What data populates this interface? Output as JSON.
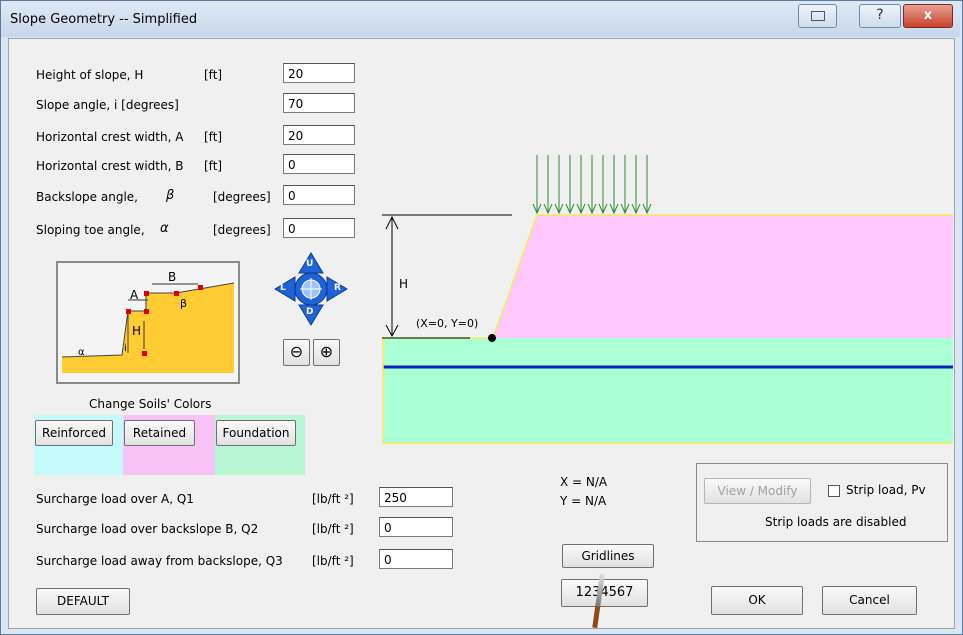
{
  "window": {
    "title": "Slope Geometry -- Simplified",
    "close_glyph": "x",
    "help_glyph": "?"
  },
  "geometry_inputs": [
    {
      "label": "Height of slope, H",
      "unit": "[ft]",
      "value": "20"
    },
    {
      "label": "Slope angle, i  [degrees]",
      "unit": "",
      "value": "70"
    },
    {
      "label": "Horizontal crest width,  A",
      "unit": "[ft]",
      "value": "20"
    },
    {
      "label": "Horizontal crest width,  B",
      "unit": "[ft]",
      "value": "0"
    },
    {
      "label": "Backslope angle,",
      "symbol": "β",
      "unit": "[degrees]",
      "value": "0"
    },
    {
      "label": "Sloping toe angle,",
      "symbol": "α",
      "unit": "[degrees]",
      "value": "0"
    }
  ],
  "schematic": {
    "labels": {
      "A": "A",
      "B": "B",
      "H": "H",
      "beta": "β",
      "i": "i",
      "alpha": "α"
    }
  },
  "navigator": {
    "up": "U",
    "down": "D",
    "left": "L",
    "right": "R"
  },
  "zoom": {
    "out": "⊖",
    "in": "⊕"
  },
  "soil_colors": {
    "title": "Change Soils' Colors",
    "buttons": [
      "Reinforced",
      "Retained",
      "Foundation"
    ],
    "swatches": [
      "#c6f9fa",
      "#f7c3f7",
      "#b9f6d6"
    ]
  },
  "surcharges": [
    {
      "label": "Surcharge load over A,  Q1",
      "unit": "[lb/ft ²]",
      "value": "250"
    },
    {
      "label": "Surcharge load over backslope B,  Q2",
      "unit": "[lb/ft ²]",
      "value": "0"
    },
    {
      "label": "Surcharge load away from backslope,  Q3",
      "unit": "[lb/ft ²]",
      "value": "0"
    }
  ],
  "buttons": {
    "default": "DEFAULT",
    "gridlines": "Gridlines",
    "counter": "1234567",
    "ok": "OK",
    "cancel": "Cancel"
  },
  "coordinates": {
    "x": "X = N/A",
    "y": "Y = N/A"
  },
  "strip_load": {
    "view_modify": "View / Modify",
    "checkbox_label": "Strip load, Pv",
    "status": "Strip loads are disabled",
    "checked": false
  },
  "drawing": {
    "height_label": "H",
    "origin_label": "(X=0, Y=0)",
    "colors": {
      "retained": "#ffc7ff",
      "foundation": "#aaffd4",
      "outline": "#f4ec5a",
      "water": "#0a23b8",
      "load": "#2f8a2f"
    }
  }
}
